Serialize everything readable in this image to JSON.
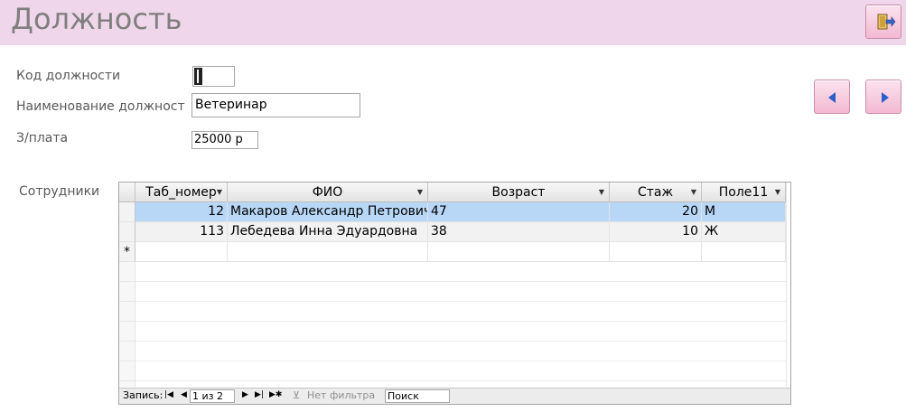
{
  "header": {
    "title": "Должность"
  },
  "form": {
    "code_label": "Код должности",
    "code_value": "",
    "name_label": "Наименование должност",
    "name_value": "Ветеринар",
    "salary_label": "З/плата",
    "salary_value": "25000 р",
    "employees_label": "Сотрудники"
  },
  "grid": {
    "columns": [
      "Таб_номер",
      "ФИО",
      "Возраст",
      "Стаж",
      "Поле11"
    ],
    "rows": [
      {
        "tab": "12",
        "fio": "Макаров Александр Петрович",
        "age": "47",
        "exp": "20",
        "field11": "М"
      },
      {
        "tab": "113",
        "fio": "Лебедева Инна Эдуардовна",
        "age": "38",
        "exp": "10",
        "field11": "Ж"
      }
    ],
    "new_row_marker": "*"
  },
  "navigation": {
    "records_label": "Запись:",
    "position": "1 из 2",
    "filter_label": "Нет фильтра",
    "search_label": "Поиск"
  },
  "colors": {
    "header_bg": "#f0d6ea",
    "selected_row": "#b8d7f7",
    "button_pink": "#f3b9d2"
  }
}
